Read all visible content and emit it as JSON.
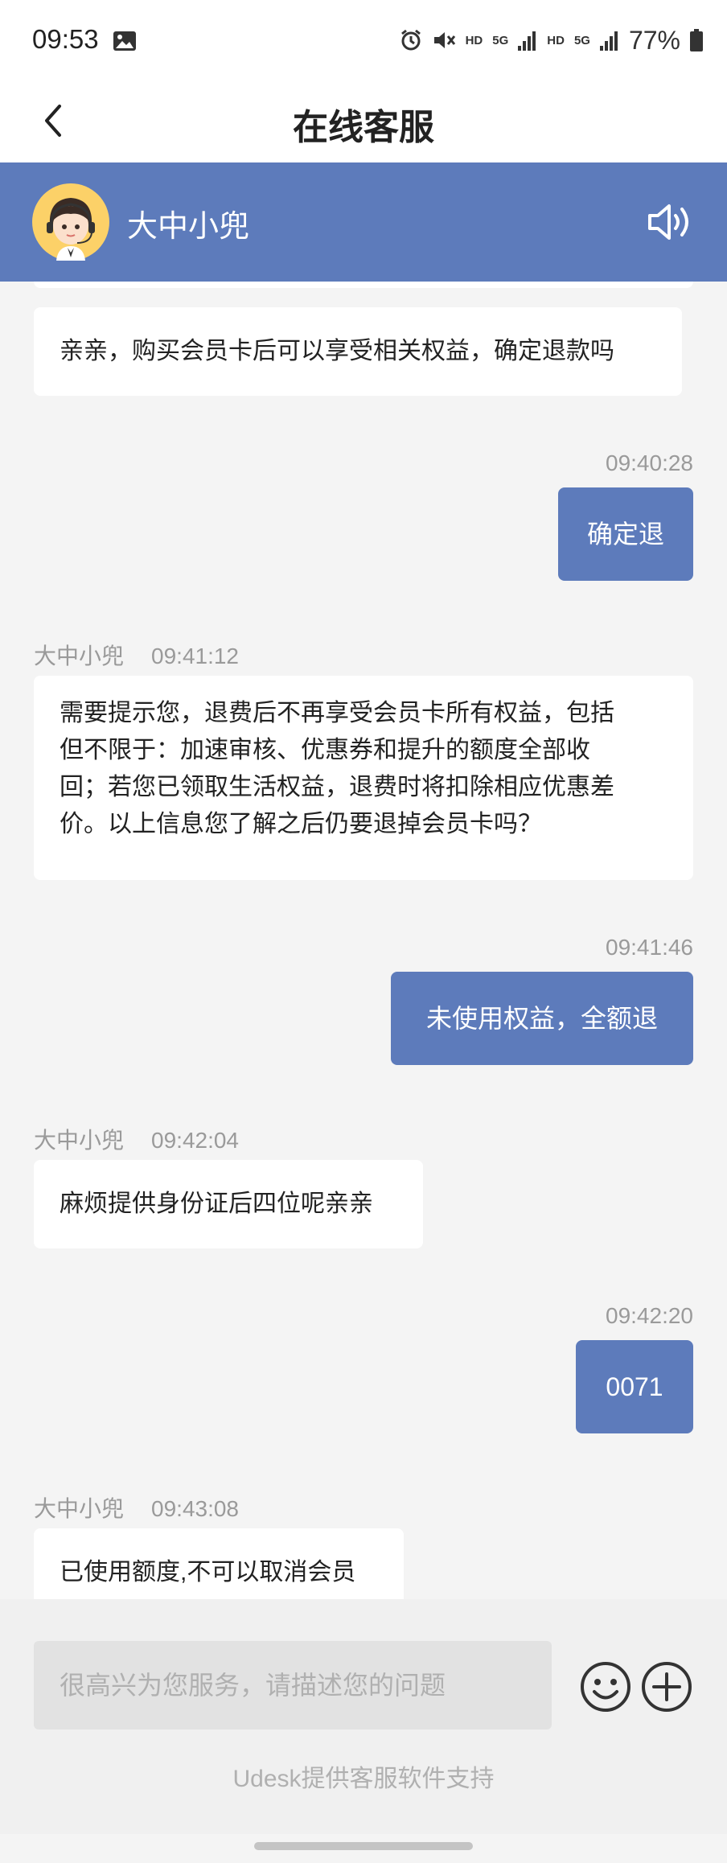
{
  "status_bar": {
    "time": "09:53",
    "hd1": "HD",
    "net1": "5G",
    "hd2": "HD",
    "net2": "5G",
    "battery": "77%"
  },
  "nav": {
    "title": "在线客服"
  },
  "agent": {
    "name": "大中小兜",
    "accent_color": "#5d7bbb"
  },
  "messages": [
    {
      "side": "left",
      "text": "亲亲，购买会员卡后可以享受相关权益，确定退款吗"
    },
    {
      "side": "right",
      "time": "09:40:28",
      "text": "确定退"
    },
    {
      "side": "left",
      "name": "大中小兜",
      "time": "09:41:12",
      "lines": [
        "需要提示您，退费后不再享受会员卡所有权益，包括",
        "但不限于：加速审核、优惠券和提升的额度全部收",
        "回；若您已领取生活权益，退费时将扣除相应优惠差",
        "价。以上信息您了解之后仍要退掉会员卡吗？"
      ]
    },
    {
      "side": "right",
      "time": "09:41:46",
      "text": "未使用权益，全额退"
    },
    {
      "side": "left",
      "name": "大中小兜",
      "time": "09:42:04",
      "text": "麻烦提供身份证后四位呢亲亲"
    },
    {
      "side": "right",
      "time": "09:42:20",
      "text": "0071"
    },
    {
      "side": "left",
      "name": "大中小兜",
      "time": "09:43:08",
      "text": "已使用额度,不可以取消会员"
    }
  ],
  "input": {
    "placeholder": "很高兴为您服务，请描述您的问题"
  },
  "footer": {
    "powered_by": "Udesk提供客服软件支持"
  },
  "icons": [
    "back-arrow-icon",
    "speaker-icon",
    "emoji-icon",
    "plus-icon",
    "gallery-icon",
    "alarm-icon",
    "mute-icon",
    "signal-icon",
    "battery-icon"
  ]
}
